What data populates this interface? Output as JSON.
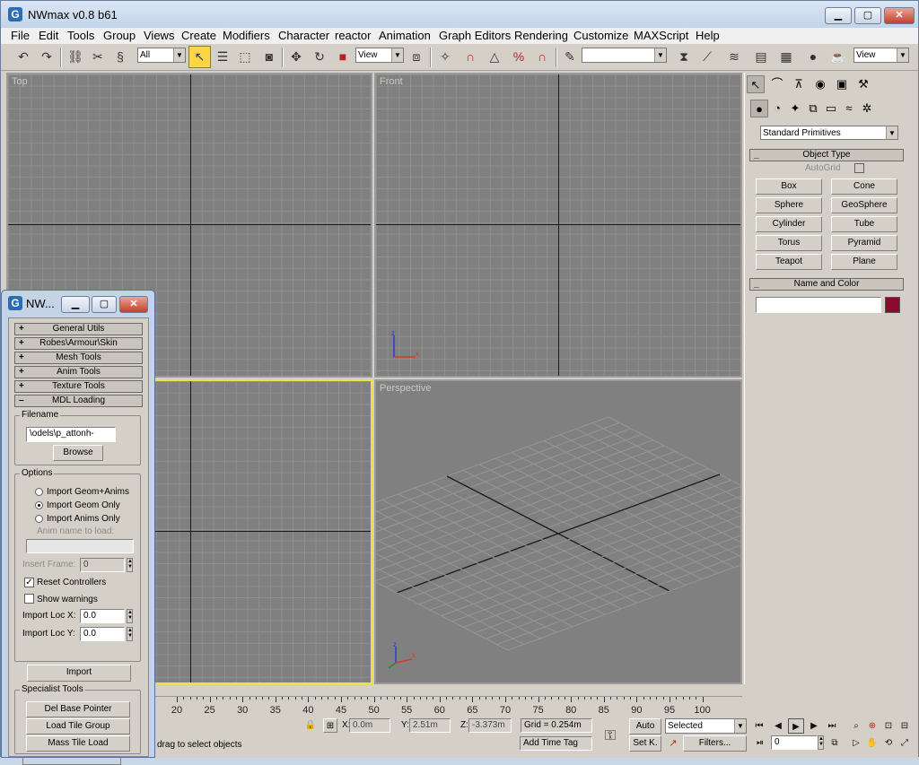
{
  "app": {
    "title": "NWmax v0.8 b61",
    "icon_name": "app-logo-icon"
  },
  "window_buttons": {
    "minimize": "▁",
    "maximize": "▢",
    "close": "✕"
  },
  "menu": [
    "File",
    "Edit",
    "Tools",
    "Group",
    "Views",
    "Create",
    "Modifiers",
    "Character",
    "reactor",
    "Animation",
    "Graph Editors",
    "Rendering",
    "Customize",
    "MAXScript",
    "Help"
  ],
  "toolbar": {
    "selection_filter": "All",
    "ref_coord": "View",
    "named_selection": "",
    "render_type": "View"
  },
  "viewports": {
    "top": "Top",
    "front": "Front",
    "left": "",
    "perspective": "Perspective"
  },
  "command_panel": {
    "category_dropdown": "Standard Primitives",
    "object_type_title": "Object Type",
    "autogrid_label": "AutoGrid",
    "primitives": [
      "Box",
      "Cone",
      "Sphere",
      "GeoSphere",
      "Cylinder",
      "Tube",
      "Torus",
      "Pyramid",
      "Teapot",
      "Plane"
    ],
    "name_color_title": "Name and Color",
    "name_value": "",
    "object_color": "#8b0a2e"
  },
  "trackbar": {
    "ticks": [
      "20",
      "25",
      "30",
      "35",
      "40",
      "45",
      "50",
      "55",
      "60",
      "65",
      "70",
      "75",
      "80",
      "85",
      "90",
      "95",
      "100"
    ]
  },
  "status": {
    "prompt_text": "drag to select objects",
    "x_label": "X:",
    "x_value": "0.0m",
    "y_label": "Y:",
    "y_value": "2.51m",
    "z_label": "Z:",
    "z_value": "-3.373m",
    "grid": "Grid = 0.254m",
    "add_time_tag": "Add Time Tag",
    "auto_key": "Auto",
    "set_key": "Set K.",
    "key_filter_select": "Selected",
    "filters": "Filters...",
    "current_frame": "0"
  },
  "nwmax_panel": {
    "title": "NW...",
    "rollouts": [
      "General Utils",
      "Robes\\Armour\\Skin",
      "Mesh Tools",
      "Anim Tools",
      "Texture Tools",
      "MDL Loading"
    ],
    "filename_group": "Filename",
    "filename_value": "\\odels\\p_attonh-ascii.mdl",
    "browse": "Browse",
    "options_group": "Options",
    "radio_options": [
      "Import Geom+Anims",
      "Import Geom Only",
      "Import Anims Only"
    ],
    "selected_radio": 1,
    "anim_name_label": "Anim name to load:",
    "anim_name_value": "",
    "insert_frame_label": "Insert Frame:",
    "insert_frame_value": "0",
    "reset_controllers": "Reset Controllers",
    "show_warnings": "Show warnings",
    "import_loc_x_label": "Import Loc X:",
    "import_loc_x_value": "0.0",
    "import_loc_y_label": "Import Loc Y:",
    "import_loc_y_value": "0.0",
    "import_button": "Import",
    "specialist_group": "Specialist Tools",
    "specialist_buttons": [
      "Del Base Pointer",
      "Load Tile Group",
      "Mass Tile Load"
    ]
  }
}
